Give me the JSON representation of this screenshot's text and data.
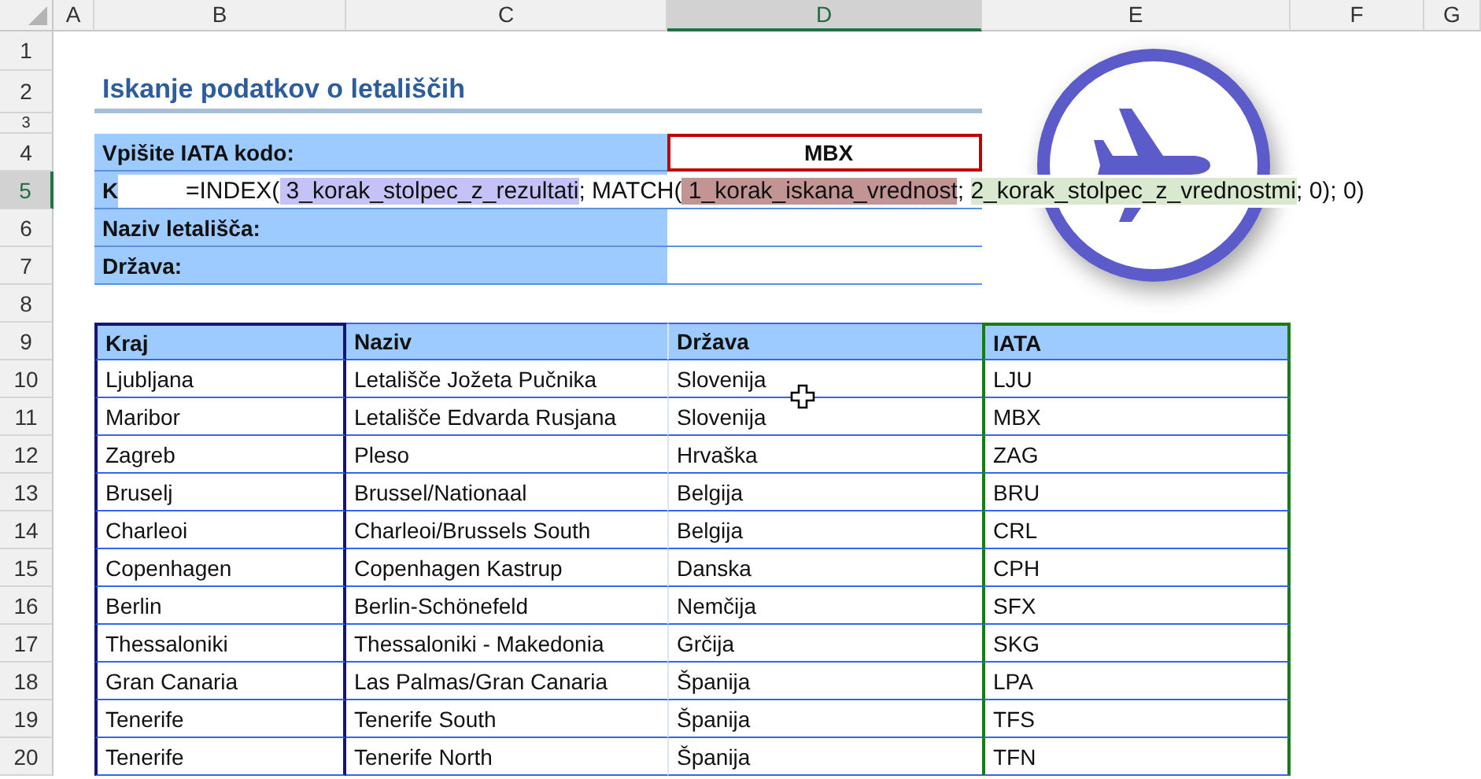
{
  "sheet": {
    "columns": [
      {
        "label": "A",
        "selected": false
      },
      {
        "label": "B",
        "selected": false
      },
      {
        "label": "C",
        "selected": false
      },
      {
        "label": "D",
        "selected": true
      },
      {
        "label": "E",
        "selected": false
      },
      {
        "label": "F",
        "selected": false
      },
      {
        "label": "G",
        "selected": false
      }
    ],
    "row_numbers": [
      {
        "label": "1",
        "selected": false
      },
      {
        "label": "2",
        "selected": false
      },
      {
        "label": "3",
        "selected": false
      },
      {
        "label": "4",
        "selected": false
      },
      {
        "label": "5",
        "selected": true
      },
      {
        "label": "6",
        "selected": false
      },
      {
        "label": "7",
        "selected": false
      },
      {
        "label": "8",
        "selected": false
      },
      {
        "label": "9",
        "selected": false
      },
      {
        "label": "10",
        "selected": false
      },
      {
        "label": "11",
        "selected": false
      },
      {
        "label": "12",
        "selected": false
      },
      {
        "label": "13",
        "selected": false
      },
      {
        "label": "14",
        "selected": false
      },
      {
        "label": "15",
        "selected": false
      },
      {
        "label": "16",
        "selected": false
      },
      {
        "label": "17",
        "selected": false
      },
      {
        "label": "18",
        "selected": false
      },
      {
        "label": "19",
        "selected": false
      },
      {
        "label": "20",
        "selected": false
      }
    ]
  },
  "title": "Iskanje podatkov o letališčih",
  "form": [
    {
      "label": "Vpišite IATA kodo:",
      "value": "MBX",
      "kind": "input"
    },
    {
      "label": "K",
      "kind": "formula"
    },
    {
      "label": "Naziv letališča:",
      "kind": "output"
    },
    {
      "label": "Država:",
      "kind": "output"
    }
  ],
  "formula_editor": {
    "parts": [
      {
        "text": "=INDEX("
      },
      {
        "text": " 3_korak_stolpec_z_rezultati",
        "color": "#c5c2f8"
      },
      {
        "text": "; MATCH("
      },
      {
        "text": " 1_korak_iskana_vrednost",
        "color": "#c39494"
      },
      {
        "text": "; "
      },
      {
        "text": "2_korak_stolpec_z_vrednostmi",
        "color": "#d8e9cf"
      },
      {
        "text": "; 0); 0)"
      }
    ]
  },
  "table": {
    "columns": [
      "Kraj",
      "Naziv",
      "Država",
      "IATA"
    ],
    "rows": [
      [
        "Ljubljana",
        "Letališče Jožeta Pučnika",
        "Slovenija",
        "LJU"
      ],
      [
        "Maribor",
        "Letališče Edvarda Rusjana",
        "Slovenija",
        "MBX"
      ],
      [
        "Zagreb",
        "Pleso",
        "Hrvaška",
        "ZAG"
      ],
      [
        "Bruselj",
        "Brussel/Nationaal",
        "Belgija",
        "BRU"
      ],
      [
        "Charleoi",
        "Charleoi/Brussels South",
        "Belgija",
        "CRL"
      ],
      [
        "Copenhagen",
        "Copenhagen Kastrup",
        "Danska",
        "CPH"
      ],
      [
        "Berlin",
        "Berlin-Schönefeld",
        "Nemčija",
        "SFX"
      ],
      [
        "Thessaloniki",
        "Thessaloniki - Makedonia",
        "Grčija",
        "SKG"
      ],
      [
        "Gran Canaria",
        "Las Palmas/Gran Canaria",
        "Španija",
        "LPA"
      ],
      [
        "Tenerife",
        "Tenerife South",
        "Španija",
        "TFS"
      ],
      [
        "Tenerife",
        "Tenerife North",
        "Španija",
        "TFN"
      ]
    ]
  }
}
